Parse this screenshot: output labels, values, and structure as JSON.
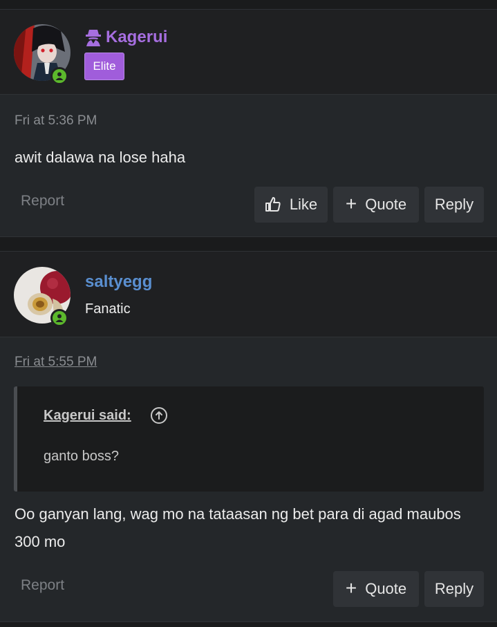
{
  "posts": [
    {
      "author": "Kagerui",
      "role_badge": "Elite",
      "date": "Fri at 5:36 PM",
      "body": "awit dalawa na lose haha",
      "actions": {
        "report": "Report",
        "like": "Like",
        "quote": "Quote",
        "reply": "Reply"
      }
    },
    {
      "author": "saltyegg",
      "user_title": "Fanatic",
      "date": "Fri at 5:55 PM",
      "quote": {
        "author": "Kagerui said:",
        "text": "ganto boss?"
      },
      "body": "Oo ganyan lang, wag mo na tataasan ng bet para di agad maubos 300 mo",
      "actions": {
        "report": "Report",
        "quote": "Quote",
        "reply": "Reply"
      }
    }
  ],
  "colors": {
    "elite_username": "#a66ee0",
    "elite_badge": "#a05ddb",
    "username_blue": "#5a8fd0",
    "online_green": "#5cb82c",
    "background": "#24272a"
  },
  "icons": [
    "spy-icon",
    "user-icon",
    "thumbs-up-icon",
    "plus-icon",
    "arrow-up-circle-icon"
  ]
}
